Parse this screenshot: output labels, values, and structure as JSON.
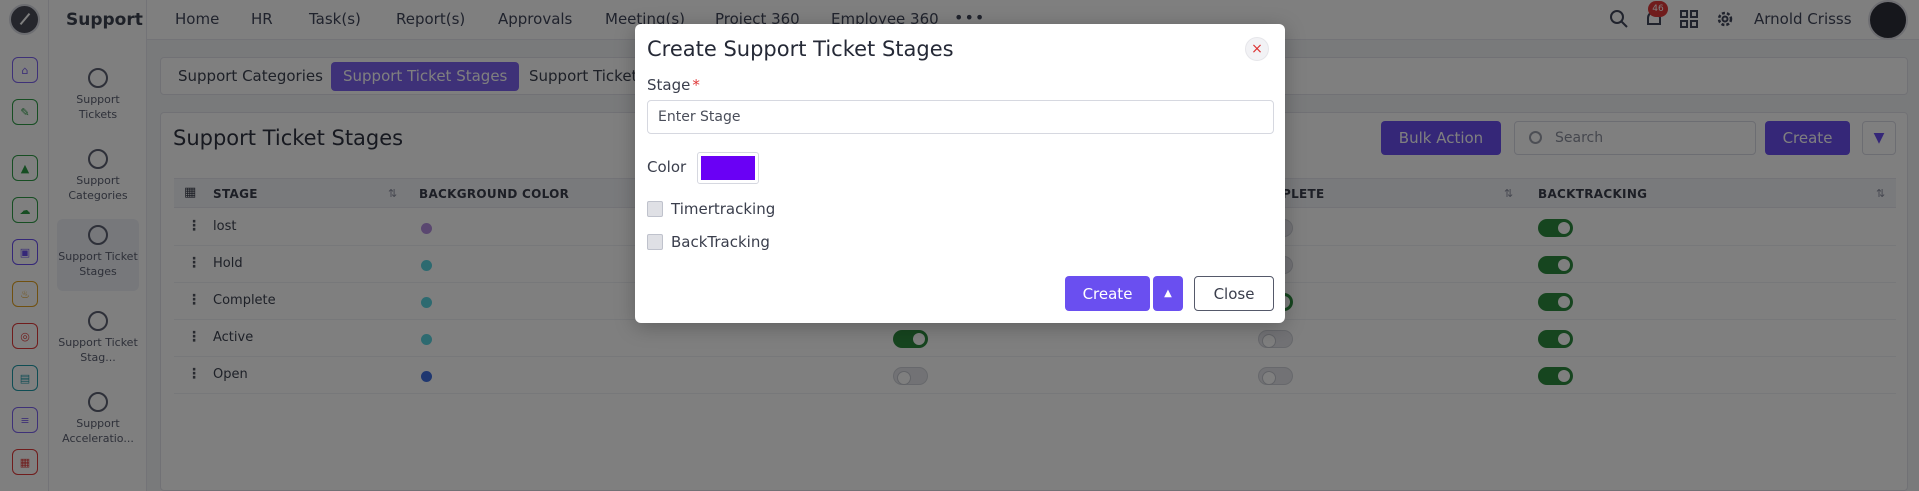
{
  "app": {
    "module_title": "Support"
  },
  "topnav": {
    "links": [
      "Home",
      "HR",
      "Task(s)",
      "Report(s)",
      "Approvals",
      "Meeting(s)",
      "Project 360",
      "Employee 360"
    ],
    "more_label": "•••",
    "notification_count": "46",
    "user_name": "Arnold Crisss"
  },
  "rail": {
    "icons": [
      {
        "name": "home-icon",
        "color": "#7d62f0"
      },
      {
        "name": "pin-icon",
        "color": "#2e9c47"
      },
      {
        "name": "chart-icon",
        "color": "#2e9c47"
      },
      {
        "name": "cloud-icon",
        "color": "#2e9c47"
      },
      {
        "name": "box-icon",
        "color": "#6a4ff0"
      },
      {
        "name": "flame-icon",
        "color": "#e0a020"
      },
      {
        "name": "target-icon",
        "color": "#e03838"
      },
      {
        "name": "doc-icon",
        "color": "#1f9aa8"
      },
      {
        "name": "layers-icon",
        "color": "#7d62f0"
      },
      {
        "name": "gift-icon",
        "color": "#e03838"
      }
    ]
  },
  "sidebar": {
    "items": [
      {
        "label": "Support Tickets"
      },
      {
        "label": "Support Categories"
      },
      {
        "label": "Support Ticket Stages"
      },
      {
        "label": "Support Ticket Stag..."
      },
      {
        "label": "Support Acceleratio..."
      }
    ]
  },
  "subtabs": [
    "Support Categories",
    "Support Ticket Stages",
    "Support Ticket"
  ],
  "main": {
    "title": "Support Ticket Stages",
    "bulk_action_label": "Bulk Action",
    "search_placeholder": "Search",
    "create_label": "Create"
  },
  "table": {
    "headers": [
      "STAGE",
      "BACKGROUND COLOR",
      "PLETE",
      "BACKTRACKING"
    ],
    "rows": [
      {
        "stage": "lost",
        "color": "#b48fe0",
        "col3": null,
        "complete": false,
        "backtracking": true
      },
      {
        "stage": "Hold",
        "color": "#5ad4e0",
        "col3": null,
        "complete": false,
        "backtracking": true
      },
      {
        "stage": "Complete",
        "color": "#5ad4e0",
        "col3": null,
        "complete": true,
        "backtracking": true
      },
      {
        "stage": "Active",
        "color": "#5ad4e0",
        "col3": true,
        "complete": false,
        "backtracking": true
      },
      {
        "stage": "Open",
        "color": "#3f6fe0",
        "col3": false,
        "complete": false,
        "backtracking": true
      }
    ]
  },
  "modal": {
    "title": "Create Support Ticket Stages",
    "close_icon": "×",
    "stage_label": "Stage",
    "required_mark": "*",
    "stage_placeholder": "Enter Stage",
    "color_label": "Color",
    "color_value": "#6a00f5",
    "timertracking_label": "Timertracking",
    "backtracking_label": "BackTracking",
    "create_label": "Create",
    "close_label": "Close"
  }
}
